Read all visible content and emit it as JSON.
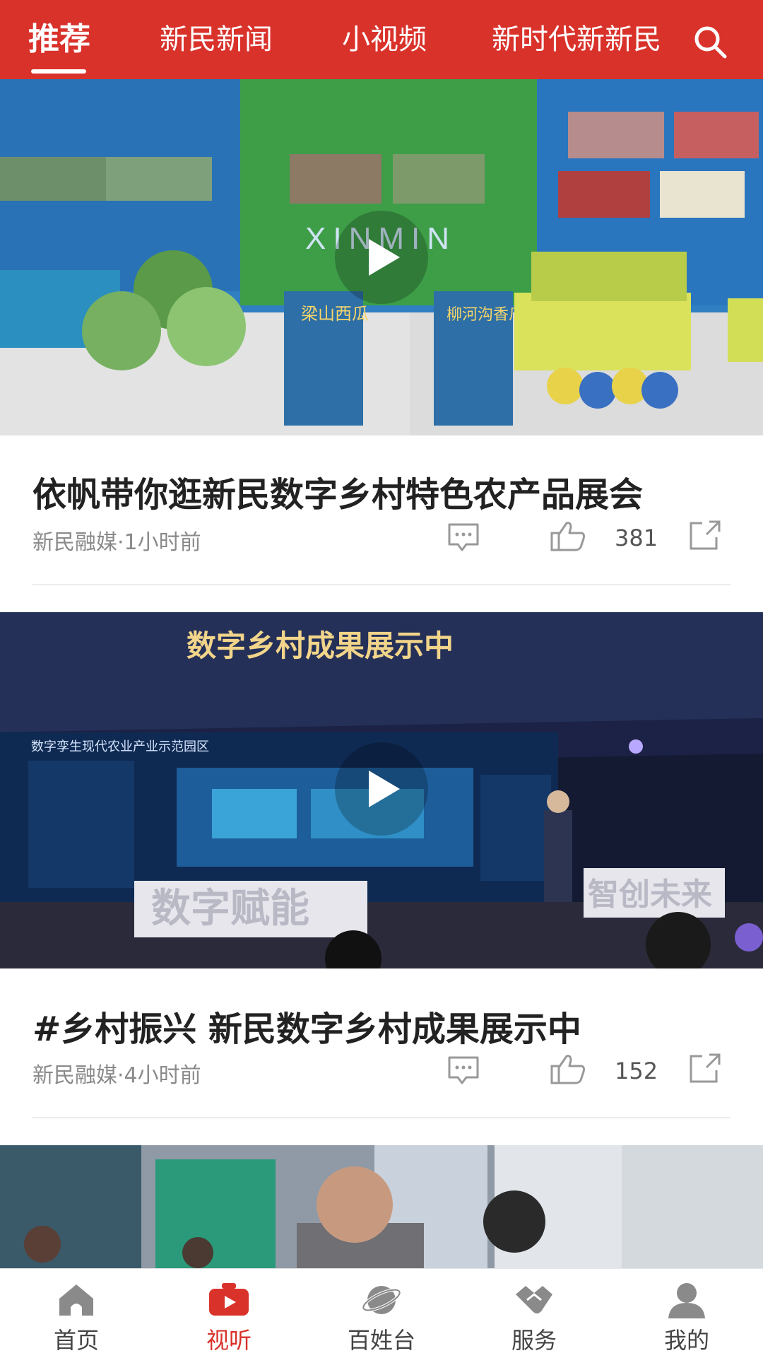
{
  "top_tabs": [
    {
      "label": "推荐",
      "active": true
    },
    {
      "label": "新民新闻",
      "active": false
    },
    {
      "label": "小视频",
      "active": false
    },
    {
      "label": "新时代新新民",
      "active": false
    }
  ],
  "icons": {
    "search": "search-icon",
    "play": "play-icon",
    "comment": "comment-icon",
    "like": "thumbs-up-icon",
    "share": "share-icon"
  },
  "colors": {
    "brand_red": "#d9322b",
    "nav_inactive": "#8a8a8a"
  },
  "feed": [
    {
      "title": "依帆带你逛新民数字乡村特色农产品展会",
      "source": "新民融媒",
      "time": "·1小时前",
      "likes": "381",
      "thumbnail_text": {
        "watermark": "XINMIN",
        "sign_1": "梁山西瓜",
        "sign_2": "柳河沟香瓜"
      }
    },
    {
      "title": "#乡村振兴 新民数字乡村成果展示中",
      "source": "新民融媒",
      "time": "·4小时前",
      "likes": "152",
      "thumbnail_text": {
        "banner": "数字乡村成果展示中",
        "screen_title": "数字孪生现代农业产业示范园区",
        "stage_left": "数字赋能",
        "stage_right": "智创未来"
      }
    }
  ],
  "bottom_nav": [
    {
      "label": "首页",
      "icon": "home-icon",
      "active": false
    },
    {
      "label": "视听",
      "icon": "video-icon",
      "active": true
    },
    {
      "label": "百姓台",
      "icon": "planet-icon",
      "active": false
    },
    {
      "label": "服务",
      "icon": "handshake-icon",
      "active": false
    },
    {
      "label": "我的",
      "icon": "user-icon",
      "active": false
    }
  ]
}
